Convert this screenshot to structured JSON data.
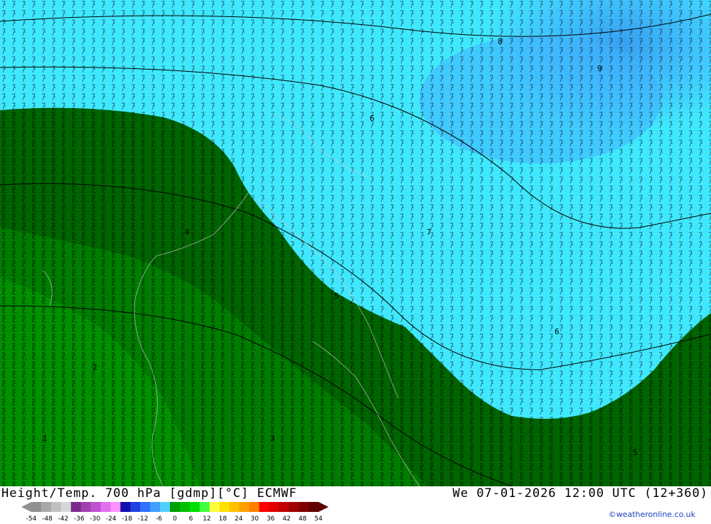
{
  "header": {
    "title": "Height/Temp. 700 hPa [gdmp][°C] ECMWF",
    "datetime": "We 07-01-2026 12:00 UTC (12+360)"
  },
  "legend": {
    "ticks": [
      "-54",
      "-48",
      "-42",
      "-36",
      "-30",
      "-24",
      "-18",
      "-12",
      "-6",
      "0",
      "6",
      "12",
      "18",
      "24",
      "30",
      "36",
      "42",
      "48",
      "54"
    ],
    "colors": [
      "#909090",
      "#a8a8a8",
      "#c0c0c0",
      "#d8d8d8",
      "#7b2a8a",
      "#a040b0",
      "#c050d0",
      "#e070f0",
      "#ff90ff",
      "#1010b0",
      "#2040e0",
      "#3070ff",
      "#40a0ff",
      "#50d0ff",
      "#00a000",
      "#00c000",
      "#00e000",
      "#40ff40",
      "#ffff40",
      "#ffe000",
      "#ffc000",
      "#ffa000",
      "#ff8000",
      "#ff0000",
      "#e00000",
      "#c00000",
      "#a00000",
      "#800000",
      "#600000"
    ]
  },
  "map": {
    "colors": {
      "green_dark": "#006400",
      "green_mid": "#007d00",
      "green_bright": "#009000",
      "cyan": "#40e8ff",
      "cyan_light": "#58f0ff",
      "blue": "#40b0ff",
      "blue_deep": "#38a0f0"
    }
  },
  "credit": "©weatheronline.co.uk"
}
